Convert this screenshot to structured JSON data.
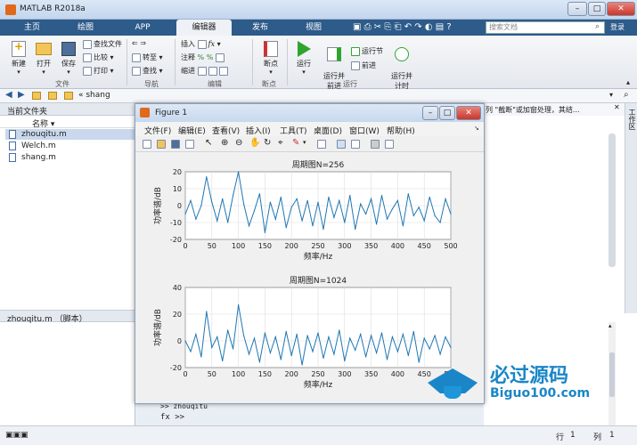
{
  "window": {
    "title": "MATLAB R2018a",
    "buttons": [
      "–",
      "□",
      "✕"
    ]
  },
  "tabs": [
    {
      "label": "主页"
    },
    {
      "label": "绘图"
    },
    {
      "label": "APP"
    },
    {
      "label": "编辑器",
      "active": true
    },
    {
      "label": "发布"
    },
    {
      "label": "视图"
    }
  ],
  "search": {
    "placeholder": "搜索文档"
  },
  "signin": "登录",
  "ribbon": {
    "new": "新建",
    "open": "打开",
    "save": "保存",
    "find_files": "查找文件",
    "compare": "比较",
    "print": "打印",
    "goto": "转至",
    "find": "查找",
    "insert": "插入",
    "comment": "注释",
    "indent": "缩进",
    "breakpoints": "断点",
    "run": "运行",
    "run_advance": "运行并\n前进",
    "run_section": "运行节",
    "advance": "前进",
    "run_time": "运行并\n计时",
    "groups": {
      "file": "文件",
      "navigate": "导航",
      "edit": "编辑",
      "breakpoints": "断点",
      "run": "运行"
    }
  },
  "address": {
    "path": "« shang"
  },
  "left": {
    "header": "当前文件夹",
    "col_name": "名称 ▾",
    "files": [
      {
        "name": "zhouqitu.m",
        "selected": true
      },
      {
        "name": "Welch.m"
      },
      {
        "name": "shang.m"
      }
    ],
    "details": "zhouqitu.m （脚本）"
  },
  "right": {
    "partial_text": "列 \"截断\"或加窗处理，其结...",
    "workspace_label": "工作区"
  },
  "command": {
    "history": ">> zhouqitu",
    "prompt": "fx >>"
  },
  "figure": {
    "title": "Figure 1",
    "menu": [
      "文件(F)",
      "编辑(E)",
      "查看(V)",
      "插入(I)",
      "工具(T)",
      "桌面(D)",
      "窗口(W)",
      "帮助(H)"
    ]
  },
  "status": {
    "row_label": "行",
    "row": "1",
    "col_label": "列",
    "col": "1"
  },
  "watermark": {
    "brand": "必过源码",
    "url": "Biguo100.com"
  },
  "chart_data": [
    {
      "type": "line",
      "title": "周期图N=256",
      "xlabel": "频率/Hz",
      "ylabel": "功率谱/dB",
      "xlim": [
        0,
        500
      ],
      "ylim": [
        -20,
        20
      ],
      "xticks": [
        0,
        50,
        100,
        150,
        200,
        250,
        300,
        350,
        400,
        450,
        500
      ],
      "yticks": [
        -20,
        -10,
        0,
        10,
        20
      ],
      "grid": true,
      "color": "#1f77b4",
      "x": [
        0,
        10,
        20,
        30,
        40,
        50,
        60,
        70,
        80,
        90,
        100,
        110,
        120,
        130,
        140,
        150,
        160,
        170,
        180,
        190,
        200,
        210,
        220,
        230,
        240,
        250,
        260,
        270,
        280,
        290,
        300,
        310,
        320,
        330,
        340,
        350,
        360,
        370,
        380,
        390,
        400,
        410,
        420,
        430,
        440,
        450,
        460,
        470,
        480,
        490,
        500
      ],
      "values": [
        -5,
        3,
        -8,
        0,
        17,
        2,
        -9,
        4,
        -10,
        6,
        20,
        1,
        -12,
        -3,
        7,
        -16,
        2,
        -8,
        5,
        -13,
        -1,
        4,
        -9,
        3,
        -12,
        2,
        -14,
        5,
        -7,
        3,
        -10,
        6,
        -14,
        1,
        -5,
        4,
        -11,
        6,
        -8,
        -2,
        3,
        -12,
        7,
        -6,
        -1,
        -9,
        5,
        -6,
        -10,
        4,
        -5
      ]
    },
    {
      "type": "line",
      "title": "周期图N=1024",
      "xlabel": "频率/Hz",
      "ylabel": "功率谱/dB",
      "xlim": [
        0,
        500
      ],
      "ylim": [
        -20,
        40
      ],
      "xticks": [
        0,
        50,
        100,
        150,
        200,
        250,
        300,
        350,
        400,
        450,
        500
      ],
      "yticks": [
        -20,
        0,
        20,
        40
      ],
      "grid": true,
      "color": "#1f77b4",
      "x": [
        0,
        10,
        20,
        30,
        40,
        50,
        60,
        70,
        80,
        90,
        100,
        110,
        120,
        130,
        140,
        150,
        160,
        170,
        180,
        190,
        200,
        210,
        220,
        230,
        240,
        250,
        260,
        270,
        280,
        290,
        300,
        310,
        320,
        330,
        340,
        350,
        360,
        370,
        380,
        390,
        400,
        410,
        420,
        430,
        440,
        450,
        460,
        470,
        480,
        490,
        500
      ],
      "values": [
        0,
        -8,
        5,
        -12,
        22,
        -5,
        3,
        -15,
        8,
        -6,
        27,
        4,
        -10,
        2,
        -16,
        6,
        -9,
        3,
        -14,
        7,
        -11,
        5,
        -18,
        4,
        -8,
        6,
        -13,
        3,
        -10,
        8,
        -15,
        2,
        -7,
        5,
        -12,
        4,
        -9,
        6,
        -14,
        3,
        -8,
        5,
        -11,
        7,
        -16,
        2,
        -6,
        4,
        -10,
        3,
        -5
      ]
    }
  ]
}
